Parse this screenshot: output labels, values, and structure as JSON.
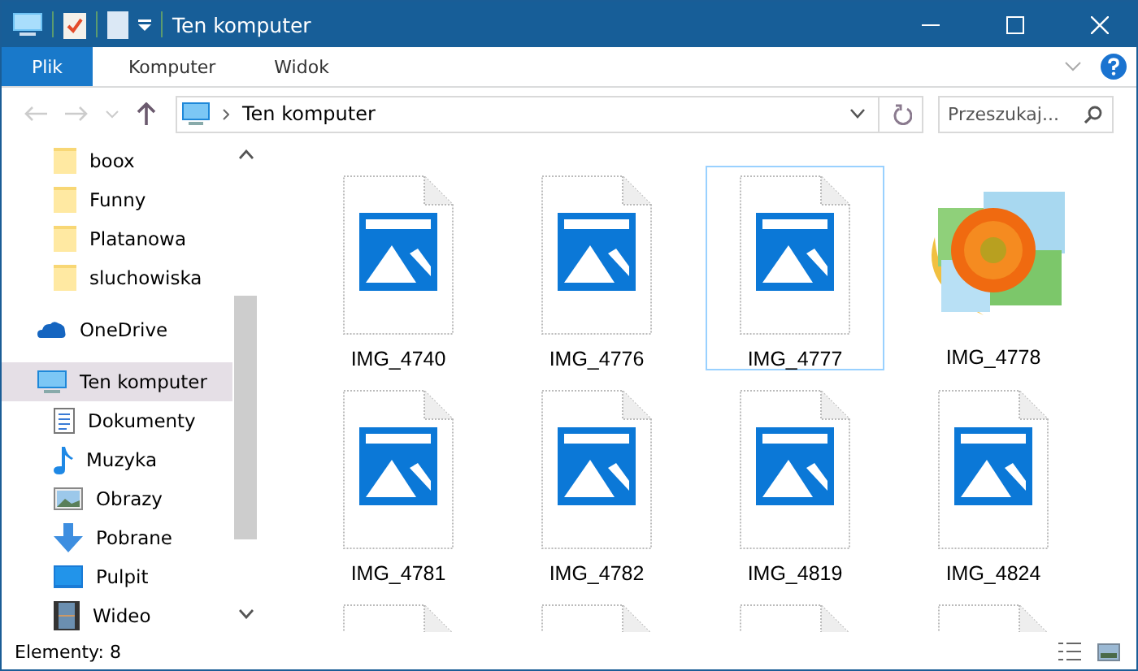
{
  "window": {
    "title": "Ten komputer"
  },
  "ribbon": {
    "tabs": [
      {
        "label": "Plik",
        "kind": "file",
        "selected": false
      },
      {
        "label": "Komputer",
        "kind": "tab",
        "selected": false
      },
      {
        "label": "Widok",
        "kind": "tab",
        "selected": false
      }
    ]
  },
  "address_bar": {
    "path": "Ten komputer",
    "search_placeholder": "Przeszukaj..."
  },
  "sidebar": {
    "pinned_folders": [
      {
        "label": "boox",
        "kind": "folder"
      },
      {
        "label": "Funny",
        "kind": "folder"
      },
      {
        "label": "Platanowa",
        "kind": "folder"
      },
      {
        "label": "sluchowiska",
        "kind": "folder"
      }
    ],
    "items": [
      {
        "label": "OneDrive",
        "kind": "cloud",
        "selected": false
      },
      {
        "label": "Ten komputer",
        "kind": "computer",
        "selected": true,
        "children": [
          {
            "label": "Dokumenty",
            "kind": "documents",
            "selected": false
          },
          {
            "label": "Muzyka",
            "kind": "music",
            "selected": false
          },
          {
            "label": "Obrazy",
            "kind": "pictures",
            "selected": false
          },
          {
            "label": "Pobrane",
            "kind": "downloads",
            "selected": false
          },
          {
            "label": "Pulpit",
            "kind": "desktop",
            "selected": false
          },
          {
            "label": "Wideo",
            "kind": "video",
            "selected": false
          }
        ]
      }
    ]
  },
  "files": [
    {
      "name": "IMG_4740",
      "kind": "image",
      "selected": false
    },
    {
      "name": "IMG_4776",
      "kind": "image",
      "selected": false
    },
    {
      "name": "IMG_4777",
      "kind": "image",
      "selected": true
    },
    {
      "name": "IMG_4778",
      "kind": "photo",
      "selected": false
    },
    {
      "name": "IMG_4781",
      "kind": "image",
      "selected": false
    },
    {
      "name": "IMG_4782",
      "kind": "image",
      "selected": false
    },
    {
      "name": "IMG_4819",
      "kind": "image",
      "selected": false
    },
    {
      "name": "IMG_4824",
      "kind": "image",
      "selected": false
    },
    {
      "kind": "image",
      "selected": false
    },
    {
      "kind": "image",
      "selected": false
    },
    {
      "kind": "image",
      "selected": false
    },
    {
      "kind": "image",
      "selected": false
    }
  ],
  "status_bar": {
    "count": "Elementy: 8"
  }
}
